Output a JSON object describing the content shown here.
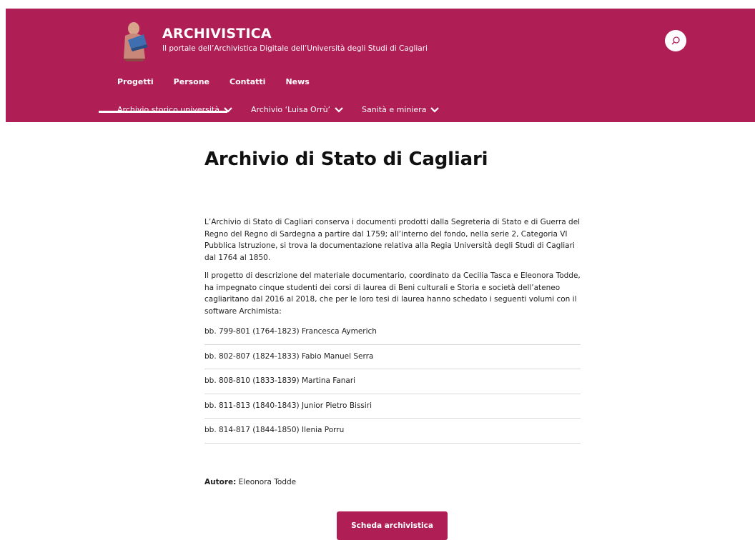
{
  "header": {
    "title": "ARCHIVISTICA",
    "subtitle": "Il portale dell’Archivistica Digitale dell’Università degli Studi di Cagliari",
    "brand_color": "#b01e56"
  },
  "nav_primary": [
    "Progetti",
    "Persone",
    "Contatti",
    "News"
  ],
  "nav_secondary": [
    "Archivio storico università",
    "Archivio ‘Luisa Orrù’",
    "Sanità e miniera"
  ],
  "page": {
    "title": "Archivio di Stato di Cagliari",
    "paragraphs": [
      "L’Archivio di Stato di Cagliari conserva i documenti prodotti dalla Segreteria di Stato e di Guerra del Regno del Regno di Sardegna a partire dal 1759; all’interno del fondo, nella serie 2, Categoria VI Pubblica Istruzione, si trova la documentazione relativa alla Regia Università degli Studi di Cagliari dal 1764 al 1850.",
      "Il progetto di descrizione del materiale documentario, coordinato da Cecilia Tasca e Eleonora Todde, ha impegnato cinque studenti dei corsi di laurea di Beni culturali e Storia e società dell’ateneo cagliaritano dal 2016 al 2018, che per le loro tesi di laurea hanno schedato i seguenti volumi con il software Archimista:"
    ],
    "volumes": [
      "bb. 799-801 (1764-1823) Francesca Aymerich",
      "bb. 802-807 (1824-1833) Fabio Manuel Serra",
      "bb. 808-810 (1833-1839) Martina Fanari",
      "bb. 811-813 (1840-1843) Junior Pietro Bissiri",
      "bb. 814-817 (1844-1850) Ilenia Porru"
    ],
    "author_label": "Autore:",
    "author_name": " Eleonora Todde",
    "cta_label": "Scheda archivistica"
  }
}
